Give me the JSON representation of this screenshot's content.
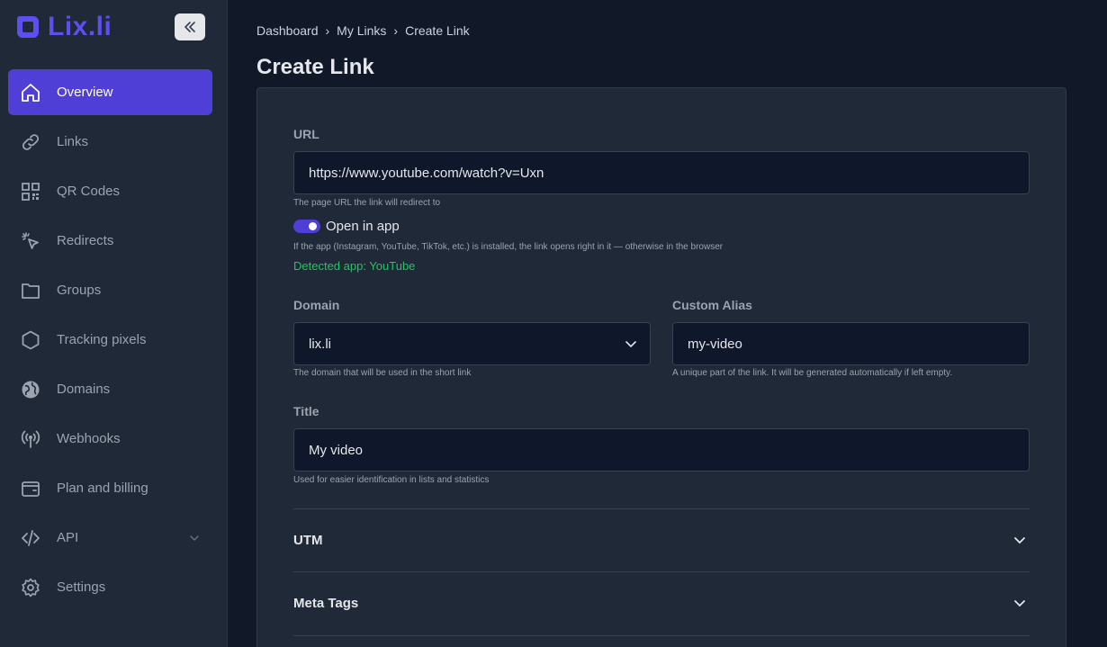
{
  "brand": {
    "name": "Lix.li",
    "color": "#5b4ff0"
  },
  "sidebar": {
    "collapse_icon": "double-chevron-left-icon",
    "items": [
      {
        "label": "Overview",
        "icon": "home-icon",
        "active": true
      },
      {
        "label": "Links",
        "icon": "link-icon"
      },
      {
        "label": "QR Codes",
        "icon": "qr-code-icon"
      },
      {
        "label": "Redirects",
        "icon": "pointer-click-icon"
      },
      {
        "label": "Groups",
        "icon": "folder-icon"
      },
      {
        "label": "Tracking pixels",
        "icon": "hexagon-icon"
      },
      {
        "label": "Domains",
        "icon": "globe-icon"
      },
      {
        "label": "Webhooks",
        "icon": "broadcast-icon"
      },
      {
        "label": "Plan and billing",
        "icon": "wallet-icon"
      },
      {
        "label": "API",
        "icon": "code-icon",
        "has_submenu": true
      },
      {
        "label": "Settings",
        "icon": "gear-icon"
      }
    ]
  },
  "breadcrumb": [
    "Dashboard",
    "My Links",
    "Create Link"
  ],
  "breadcrumb_separator": "›",
  "page_title": "Create Link",
  "form": {
    "url": {
      "label": "URL",
      "value": "https://www.youtube.com/watch?v=Uxn",
      "hint": "The page URL the link will redirect to"
    },
    "open_in_app": {
      "label": "Open in app",
      "enabled": true,
      "hint": "If the app (Instagram, YouTube, TikTok, etc.) is installed, the link opens right in it — otherwise in the browser",
      "detected": "Detected app: YouTube"
    },
    "domain": {
      "label": "Domain",
      "value": "lix.li",
      "hint": "The domain that will be used in the short link"
    },
    "alias": {
      "label": "Custom Alias",
      "value": "my-video",
      "hint": "A unique part of the link. It will be generated automatically if left empty."
    },
    "title": {
      "label": "Title",
      "value": "My video",
      "hint": "Used for easier identification in lists and statistics"
    },
    "sections": [
      "UTM",
      "Meta Tags"
    ]
  },
  "colors": {
    "accent": "#4f3fd6",
    "success": "#22c55e",
    "background": "#111827",
    "panel": "#1f2937"
  }
}
